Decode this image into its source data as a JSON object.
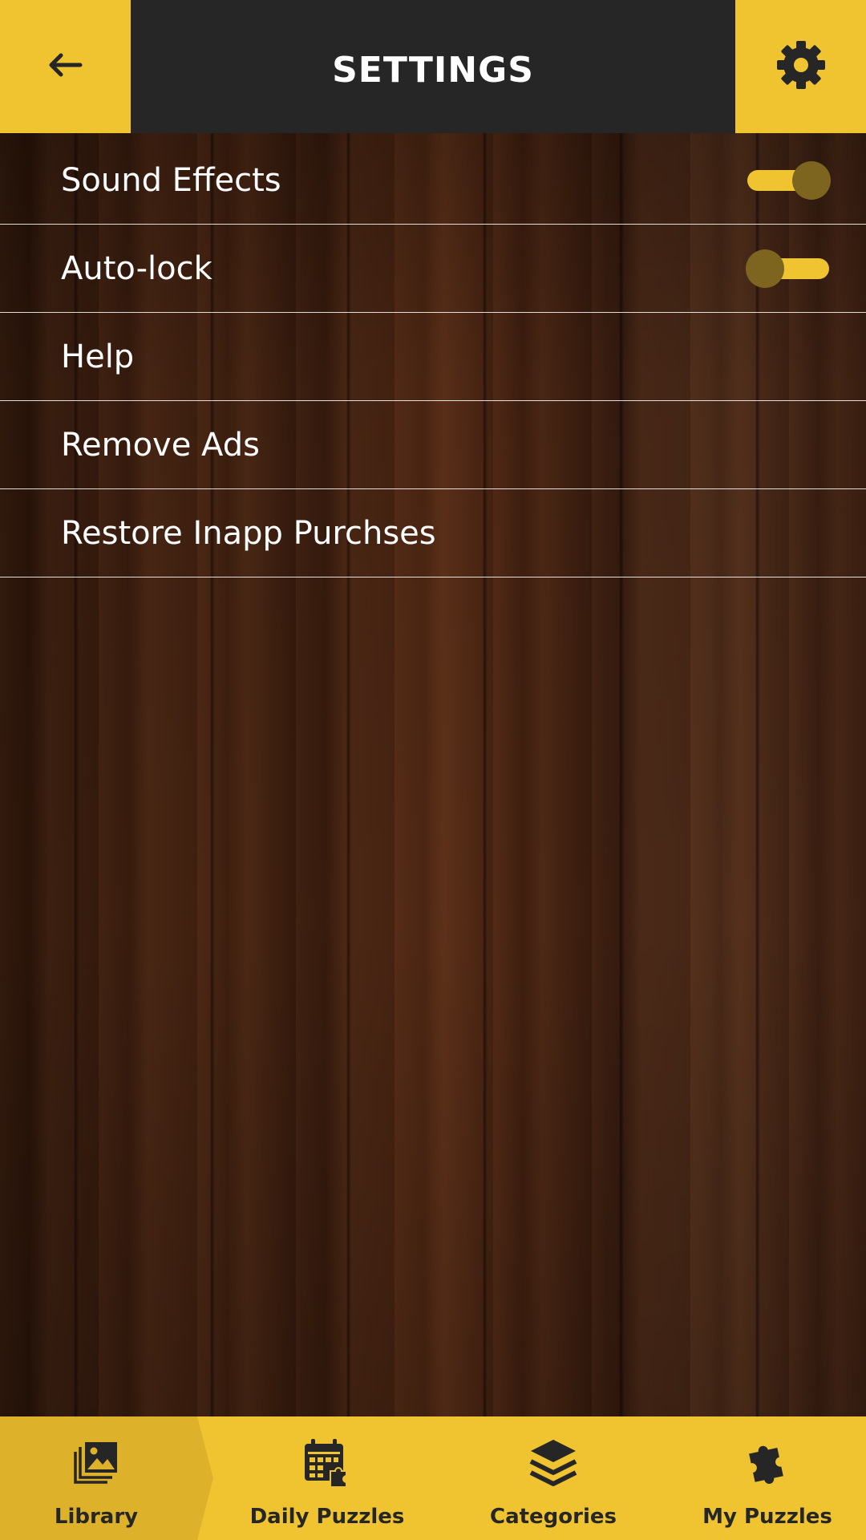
{
  "header": {
    "title": "SETTINGS",
    "back_icon": "arrow-left-icon",
    "settings_icon": "gear-icon"
  },
  "settings": {
    "items": [
      {
        "label": "Sound Effects",
        "type": "toggle",
        "on": true
      },
      {
        "label": "Auto-lock",
        "type": "toggle",
        "on": false
      },
      {
        "label": "Help",
        "type": "link"
      },
      {
        "label": "Remove Ads",
        "type": "link"
      },
      {
        "label": "Restore Inapp Purchses",
        "type": "link"
      }
    ]
  },
  "bottom_nav": {
    "items": [
      {
        "label": "Library",
        "icon": "images-icon",
        "active": true
      },
      {
        "label": "Daily Puzzles",
        "icon": "calendar-puzzle-icon",
        "active": false
      },
      {
        "label": "Categories",
        "icon": "layers-icon",
        "active": false
      },
      {
        "label": "My Puzzles",
        "icon": "puzzle-piece-icon",
        "active": false
      }
    ]
  },
  "colors": {
    "accent": "#f0c431",
    "header_dark": "#262626",
    "toggle_knob": "#7d6520",
    "active_tab": "#ddb12a"
  }
}
